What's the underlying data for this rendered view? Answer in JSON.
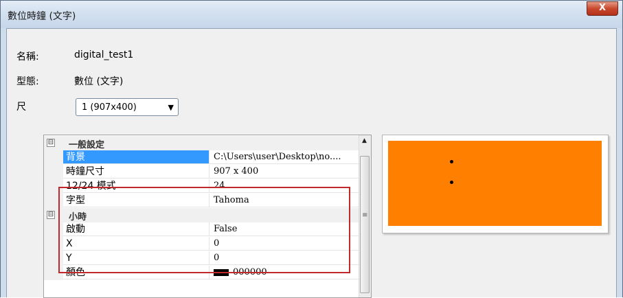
{
  "window": {
    "title": "數位時鐘 (文字)",
    "close_label": "X"
  },
  "form": {
    "name_label": "名稱:",
    "name_value": "digital_test1",
    "type_label": "型態:",
    "type_value": "數位 (文字)",
    "size_label": "尺",
    "size_selected": "1  (907x400)"
  },
  "grid": {
    "rows": [
      {
        "kind": "category",
        "toggle": "⊟",
        "label": "一般設定"
      },
      {
        "kind": "prop",
        "name": "背景",
        "value": "C:\\Users\\user\\Desktop\\no....",
        "selected": true
      },
      {
        "kind": "prop",
        "name": "時鐘尺寸",
        "value": "907 x 400"
      },
      {
        "kind": "prop",
        "name": "12/24 模式",
        "value": "24"
      },
      {
        "kind": "prop",
        "name": "字型",
        "value": "Tahoma"
      },
      {
        "kind": "category",
        "toggle": "⊟",
        "label": "小時"
      },
      {
        "kind": "prop",
        "name": "啟動",
        "value": "False"
      },
      {
        "kind": "prop",
        "name": "X",
        "value": "0"
      },
      {
        "kind": "prop",
        "name": "Y",
        "value": "0"
      },
      {
        "kind": "prop",
        "name": "顏色",
        "value": "000000",
        "swatch": "#000000"
      }
    ]
  },
  "preview": {
    "background": "#ff8000"
  }
}
